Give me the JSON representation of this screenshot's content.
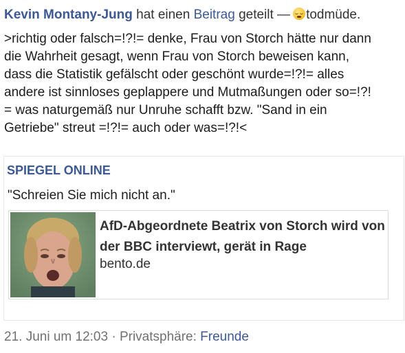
{
  "header": {
    "author": "Kevin Montany-Jung",
    "verb": "hat einen",
    "object_link": "Beitrag",
    "action": "geteilt —",
    "emoji_icon": "sleepy-face-icon",
    "feeling": "todmüde."
  },
  "post": {
    "text": ">richtig oder falsch=!?!= denke, Frau von Storch hätte nur dann\ndie Wahrheit gesagt, wenn Frau von Storch beweisen kann,\ndass die Statistik gefälscht oder geschönt wurde=!?!= alles\nandere ist sinnloses geplappere und Mutmaßungen oder so=!?!\n= was naturgemäß nur Unruhe schafft bzw. \"Sand in ein\nGetriebe\" streut =!?!= auch oder was=!?!<"
  },
  "shared": {
    "source": "SPIEGEL ONLINE",
    "quote": "\"Schreien Sie mich nicht an.\"",
    "card": {
      "title": "AfD-Abgeordnete Beatrix von Storch wird von der BBC interviewt, gerät in Rage",
      "domain": "bento.de"
    }
  },
  "meta": {
    "date": "21. Juni um 12:03",
    "separator": "·",
    "privacy_label": "Privatsphäre:",
    "privacy_value": "Freunde"
  },
  "colors": {
    "link": "#3b5998",
    "text": "#1d1d1d",
    "muted": "#707070"
  }
}
